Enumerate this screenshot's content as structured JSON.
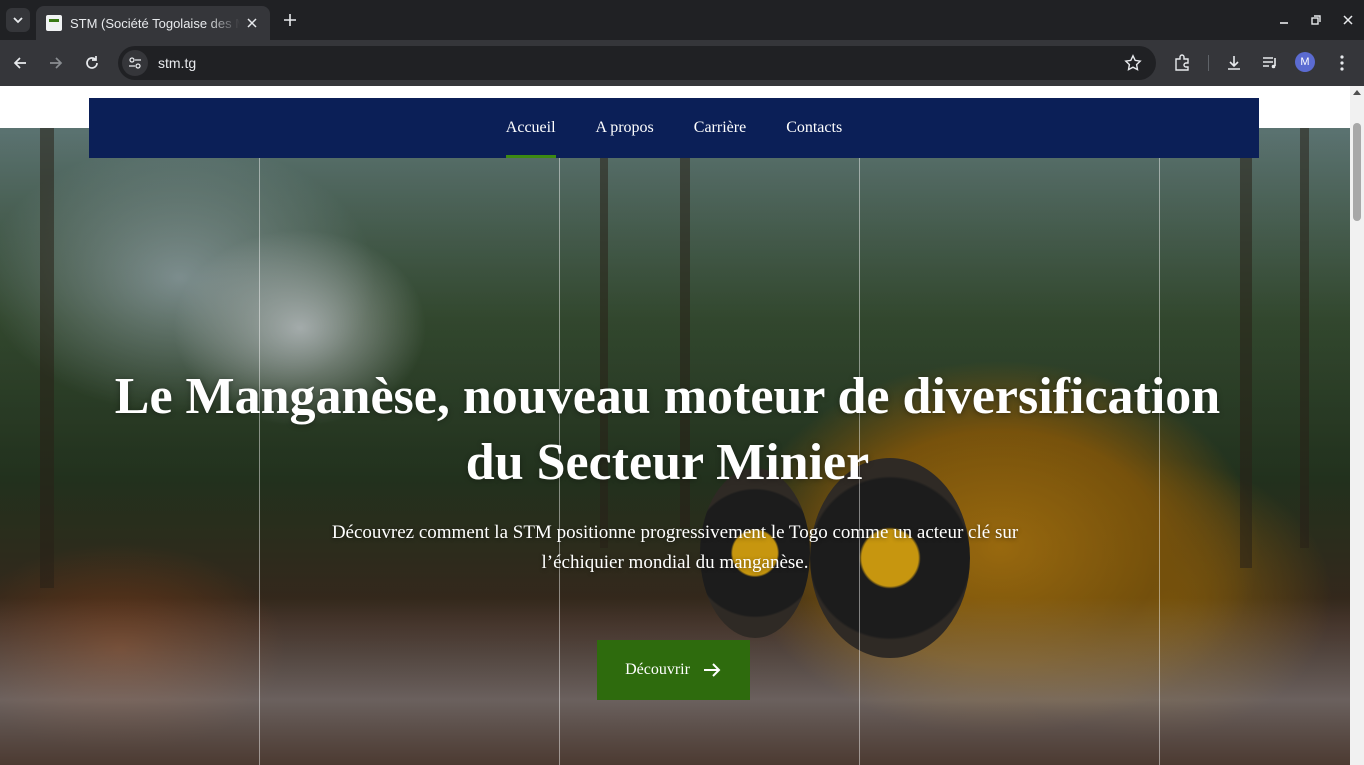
{
  "browser": {
    "tab_title": "STM (Société Togolaise des Mines)",
    "url": "stm.tg",
    "profile_initial": "M",
    "icons": [
      "tab-search-icon",
      "close-icon",
      "plus-icon",
      "minimize-icon",
      "restore-icon",
      "close-window-icon",
      "back-icon",
      "forward-icon",
      "reload-icon",
      "site-info-icon",
      "star-icon",
      "extensions-icon",
      "download-icon",
      "media-icon",
      "menu-icon"
    ]
  },
  "nav": {
    "items": [
      {
        "label": "Accueil",
        "active": true
      },
      {
        "label": "A propos",
        "active": false
      },
      {
        "label": "Carrière",
        "active": false
      },
      {
        "label": "Contacts",
        "active": false
      }
    ]
  },
  "hero": {
    "title": "Le Manganèse, nouveau moteur de diversification du Secteur Minier",
    "subtitle": "Découvrez comment la STM positionne progressivement le Togo comme un acteur clé sur l’échiquier mondial du manganèse.",
    "cta_label": "Découvrir"
  },
  "colors": {
    "nav_bg": "#0b1f57",
    "accent_green": "#2e6b0d",
    "active_underline": "#3d8a12"
  }
}
